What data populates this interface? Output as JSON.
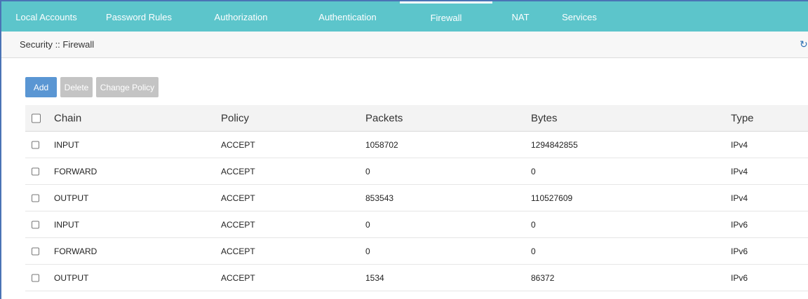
{
  "nav": {
    "tabs": [
      {
        "label": "Local Accounts"
      },
      {
        "label": "Password Rules"
      },
      {
        "label": "Authorization"
      },
      {
        "label": "Authentication"
      },
      {
        "label": "Firewall",
        "active": true
      },
      {
        "label": "NAT"
      },
      {
        "label": "Services"
      }
    ]
  },
  "breadcrumb": "Security :: Firewall",
  "refresh_icon": "refresh-icon",
  "toolbar": {
    "add_label": "Add",
    "delete_label": "Delete",
    "change_policy_label": "Change Policy"
  },
  "colors": {
    "nav_bg": "#5cc5cb",
    "primary_button": "#5a96d3",
    "disabled_button": "#c4c4c4",
    "link": "#2a6fb3"
  },
  "table": {
    "headers": {
      "chain": "Chain",
      "policy": "Policy",
      "packets": "Packets",
      "bytes": "Bytes",
      "type": "Type"
    },
    "rows": [
      {
        "chain": "INPUT",
        "policy": "ACCEPT",
        "packets": "1058702",
        "bytes": "1294842855",
        "type": "IPv4"
      },
      {
        "chain": "FORWARD",
        "policy": "ACCEPT",
        "packets": "0",
        "bytes": "0",
        "type": "IPv4"
      },
      {
        "chain": "OUTPUT",
        "policy": "ACCEPT",
        "packets": "853543",
        "bytes": "110527609",
        "type": "IPv4"
      },
      {
        "chain": "INPUT",
        "policy": "ACCEPT",
        "packets": "0",
        "bytes": "0",
        "type": "IPv6"
      },
      {
        "chain": "FORWARD",
        "policy": "ACCEPT",
        "packets": "0",
        "bytes": "0",
        "type": "IPv6"
      },
      {
        "chain": "OUTPUT",
        "policy": "ACCEPT",
        "packets": "1534",
        "bytes": "86372",
        "type": "IPv6"
      }
    ]
  }
}
